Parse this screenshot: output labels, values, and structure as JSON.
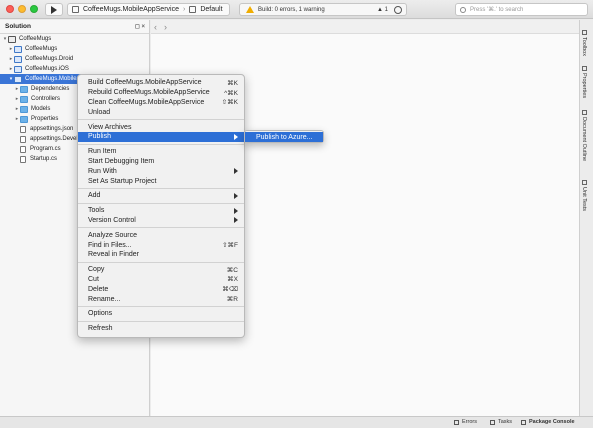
{
  "toolbar": {
    "project": "CoffeeMugs.MobileAppService",
    "config": "Default",
    "status": "Build: 0 errors, 1 warning",
    "warning_count": "1",
    "search_placeholder": "Press '⌘.' to search"
  },
  "solution_pad": {
    "title": "Solution",
    "controls": "◻ ×",
    "items": [
      {
        "label": "CoffeeMugs",
        "arrow": "▾",
        "icon": "solution-icon",
        "indent": 0
      },
      {
        "label": "CoffeeMugs",
        "arrow": "▸",
        "icon": "project-icon",
        "indent": 1
      },
      {
        "label": "CoffeeMugs.Droid",
        "arrow": "▸",
        "icon": "project-icon",
        "indent": 1
      },
      {
        "label": "CoffeeMugs.iOS",
        "arrow": "▸",
        "icon": "project-icon",
        "indent": 1
      },
      {
        "label": "CoffeeMugs.MobileAppService",
        "arrow": "▾",
        "icon": "project-icon",
        "indent": 1,
        "selected": true
      },
      {
        "label": "Dependencies",
        "arrow": "▸",
        "icon": "folder-icon",
        "indent": 2
      },
      {
        "label": "Controllers",
        "arrow": "▸",
        "icon": "folder-icon",
        "indent": 2
      },
      {
        "label": "Models",
        "arrow": "▸",
        "icon": "folder-icon",
        "indent": 2
      },
      {
        "label": "Properties",
        "arrow": "▸",
        "icon": "folder-icon",
        "indent": 2
      },
      {
        "label": "appsettings.json",
        "arrow": "",
        "icon": "file-icon",
        "indent": 2
      },
      {
        "label": "appsettings.Development.json",
        "arrow": "",
        "icon": "file-icon",
        "indent": 2
      },
      {
        "label": "Program.cs",
        "arrow": "",
        "icon": "file-icon",
        "indent": 2
      },
      {
        "label": "Startup.cs",
        "arrow": "",
        "icon": "file-icon",
        "indent": 2
      }
    ]
  },
  "editor_nav": {
    "back": "‹",
    "forward": "›"
  },
  "context_menu": {
    "groups": [
      [
        {
          "label": "Build CoffeeMugs.MobileAppService",
          "shortcut": "⌘K"
        },
        {
          "label": "Rebuild CoffeeMugs.MobileAppService",
          "shortcut": "^⌘K"
        },
        {
          "label": "Clean CoffeeMugs.MobileAppService",
          "shortcut": "⇧⌘K"
        },
        {
          "label": "Unload",
          "shortcut": ""
        }
      ],
      [
        {
          "label": "View Archives",
          "shortcut": ""
        },
        {
          "label": "Publish",
          "shortcut": "",
          "submenu": true,
          "highlighted": true
        }
      ],
      [
        {
          "label": "Run Item",
          "shortcut": ""
        },
        {
          "label": "Start Debugging Item",
          "shortcut": ""
        },
        {
          "label": "Run With",
          "shortcut": "",
          "submenu": true
        },
        {
          "label": "Set As Startup Project",
          "shortcut": ""
        }
      ],
      [
        {
          "label": "Add",
          "shortcut": "",
          "submenu": true
        }
      ],
      [
        {
          "label": "Tools",
          "shortcut": "",
          "submenu": true
        },
        {
          "label": "Version Control",
          "shortcut": "",
          "submenu": true
        }
      ],
      [
        {
          "label": "Analyze Source",
          "shortcut": ""
        },
        {
          "label": "Find in Files...",
          "shortcut": "⇧⌘F"
        },
        {
          "label": "Reveal in Finder",
          "shortcut": ""
        }
      ],
      [
        {
          "label": "Copy",
          "shortcut": "⌘C"
        },
        {
          "label": "Cut",
          "shortcut": "⌘X"
        },
        {
          "label": "Delete",
          "shortcut": "⌘⌫"
        },
        {
          "label": "Rename...",
          "shortcut": "⌘R"
        }
      ],
      [
        {
          "label": "Options",
          "shortcut": ""
        }
      ],
      [
        {
          "label": "Refresh",
          "shortcut": ""
        }
      ]
    ]
  },
  "submenu": {
    "label": "Publish to Azure..."
  },
  "right_pads": [
    {
      "label": "Toolbox",
      "icon": "toolbox-icon"
    },
    {
      "label": "Properties",
      "icon": "properties-icon"
    },
    {
      "label": "Document Outline",
      "icon": "outline-icon"
    },
    {
      "label": "Unit Tests",
      "icon": "unit-tests-icon"
    }
  ],
  "bottom_bar": {
    "errors": "Errors",
    "tasks": "Tasks",
    "package_console": "Package Console"
  }
}
